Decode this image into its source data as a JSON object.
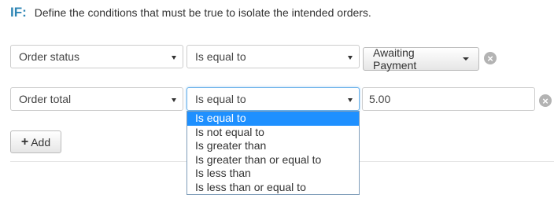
{
  "header": {
    "if_label": "IF:",
    "description": "Define the conditions that must be true to isolate the intended orders."
  },
  "row1": {
    "field": "Order status",
    "operator": "Is equal to",
    "value_button": "Awaiting Payment"
  },
  "row2": {
    "field": "Order total",
    "operator": "Is equal to",
    "value": "5.00"
  },
  "operator_options": [
    "Is equal to",
    "Is not equal to",
    "Is greater than",
    "Is greater than or equal to",
    "Is less than",
    "Is less than or equal to"
  ],
  "add_button": {
    "label": "Add"
  },
  "icons": {
    "remove": "remove-circle-icon",
    "add": "plus-icon",
    "caret": "caret-down-icon"
  },
  "colors": {
    "accent": "#2e86b5",
    "selected_option": "#1e90ff",
    "remove_icon": "#b3b3b3"
  }
}
